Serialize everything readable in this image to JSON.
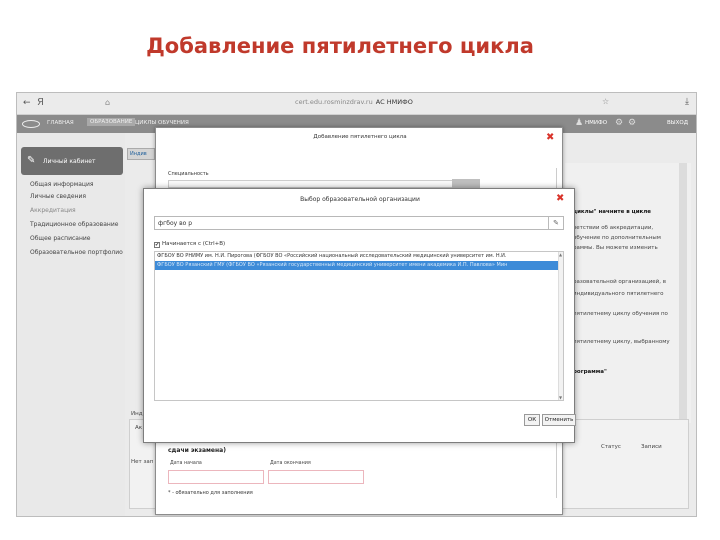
{
  "slide": {
    "title": "Добавление пятилетнего цикла"
  },
  "browser": {
    "back": "←",
    "yandex": "Я",
    "lock": "⌂",
    "address_url": "cert.edu.rosminzdrav.ru",
    "address_title": "АС НМИФО",
    "star": "☆",
    "download": "⤓"
  },
  "navbar": {
    "items": [
      "ГЛАВНАЯ",
      "ОБРАЗОВАНИЕ",
      "ЦИКЛЫ ОБУЧЕНИЯ"
    ],
    "user": "НМИФО",
    "exit": "ВЫХОД"
  },
  "sidebar": {
    "header": "Личный кабинет",
    "items": [
      "Общая информация",
      "Личные сведения",
      "Аккредитация",
      "Традиционное образование",
      "Общее расписание",
      "Образовательное портфолио"
    ]
  },
  "content": {
    "tab": "Индив",
    "right_lines": [
      "циклы\" начните в цикле",
      "ветствии об аккредитации,",
      "обучение по дополнительным",
      "раммы. Вы можете изменить",
      "разовательной организацией, в",
      "индивидуального пятилетнего",
      "пятилетнему циклу обучения по",
      "пятилетнему циклу, выбранному",
      "рограмма\""
    ],
    "bottom_labels": [
      "Инд",
      "Ак",
      "Нет зап",
      "Статус",
      "Записи"
    ]
  },
  "dialog_cycle": {
    "title": "Добавление пятилетнего цикла",
    "close": "✖",
    "specialty_label": "Специальность",
    "exam_heading": "сдачи экзамена)",
    "date_start_label": "Дата начала",
    "date_end_label": "Дата окончания",
    "required_note": "* - обязательно для заполнения"
  },
  "dialog_org": {
    "title": "Выбор образовательной организации",
    "close": "✖",
    "search_value": "фгбоу во р",
    "edit_icon": "✎",
    "checkbox_label": "Начинается с (Ctrl+B)",
    "checkbox_mark": "✔",
    "results": [
      "ФГБОУ ВО РНИМУ им. Н.И. Пирогова (ФГБОУ ВО «Российский национальный исследовательский медицинский университет им. Н.И.",
      "ФГБОУ ВО Рязанский ГМУ (ФГБОУ ВО «Рязанский государственный медицинский университет имени академика И.П. Павлова» Мин"
    ],
    "scroll_up": "▲",
    "scroll_down": "▼",
    "ok_label": "ОК",
    "cancel_label": "Отменить"
  }
}
